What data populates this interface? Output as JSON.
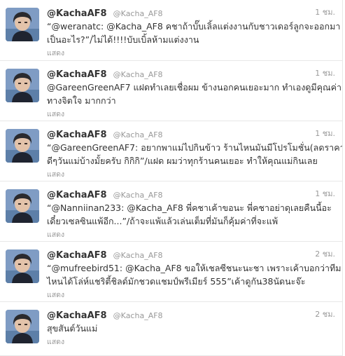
{
  "tweets": [
    {
      "name": "@KachaAF8",
      "handle": "@Kacha_AF8",
      "time": "1 ชม.",
      "lines": [
        "“@weranatc: @Kacha_AF8 คชาถ้าบั๊บเลิ้ลแต่งงานกับชาวเดอร์ลูกจะออกมา",
        "เป็นอะไร?”/ไม่ได้!!!!บับเบิ้ลห้ามแต่งงาน"
      ],
      "expand": "แสดง"
    },
    {
      "name": "@KachaAF8",
      "handle": "@Kacha_AF8",
      "time": "1 ชม.",
      "lines": [
        "@GareenGreenAF7 แฝดทำเลยเชื่อผม ข้างนอกคนเยอะมาก ทำเองดูมีคุณค่า",
        "ทางจิตใจ มากกว่า"
      ],
      "expand": "แสดง"
    },
    {
      "name": "@KachaAF8",
      "handle": "@Kacha_AF8",
      "time": "1 ชม.",
      "lines": [
        "“@GareenGreenAF7: อยากพาแม่ไปกินข้าว ร้านไหนมันมีโปรโมชั่น(ลดราคา)",
        "ดีๆวันแม่บ้างมั้ยครับ กิกิกิ”/แฝด ผมว่าทุกร้านคนเยอะ ทำให้คุณแม่กินเลย"
      ],
      "expand": "แสดง"
    },
    {
      "name": "@KachaAF8",
      "handle": "@Kacha_AF8",
      "time": "1 ชม.",
      "lines": [
        "“@Nanniinan233: @Kacha_AF8 พี่คชาเค้าขอนะ พี่คชาอย่าดุเลยคืนนี้อะ",
        "เดี๋ยวเซลซินแพ้อีก...”/ถ้าจะแพ้แล้วเล่นเต็มที่มันก็คุ้มค่าที่จะแพ้"
      ],
      "expand": "แสดง"
    },
    {
      "name": "@KachaAF8",
      "handle": "@Kacha_AF8",
      "time": "2 ชม.",
      "lines": [
        "“@mufreebird51: @Kacha_AF8 ขอให้เชลซีชนะนะชา เพราะเค้าบอกว่าทีม",
        "ไหนได้โล่ห์แชริตี้ชิลด์มักชวดแชมป์พรีเมียร์ 555”เค้าดูกัน38นัดนะจ๊ะ"
      ],
      "expand": "แสดง"
    },
    {
      "name": "@KachaAF8",
      "handle": "@Kacha_AF8",
      "time": "2 ชม.",
      "lines": [
        "สุขสันต์วันแม่"
      ],
      "expand": "แสดง"
    }
  ]
}
